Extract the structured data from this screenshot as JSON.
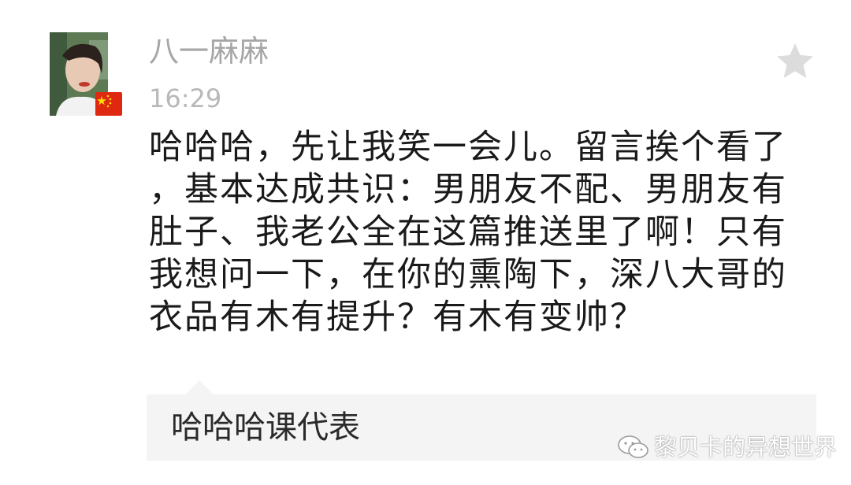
{
  "post": {
    "username": "八一麻麻",
    "time": "16:29",
    "comment_lines": [
      "哈哈哈，先让我笑一会儿。留言挨个看了",
      "，基本达成共识：男朋友不配、男朋友有",
      "肚子、我老公全在这篇推送里了啊！只有",
      "我想问一下，在你的熏陶下，深八大哥的",
      "衣品有木有提升？有木有变帅？"
    ],
    "star_icon": "star-icon",
    "avatar_icon": "avatar",
    "flag_icon": "china-flag-icon"
  },
  "reply": {
    "text": "哈哈哈课代表"
  },
  "watermark": {
    "icon": "wechat-icon",
    "text": "黎贝卡的异想世界"
  },
  "colors": {
    "username": "#a6a6a6",
    "time": "#b8b8b8",
    "comment": "#1a1a1a",
    "reply_bg": "#f4f4f4",
    "star": "#dcdcdc"
  }
}
